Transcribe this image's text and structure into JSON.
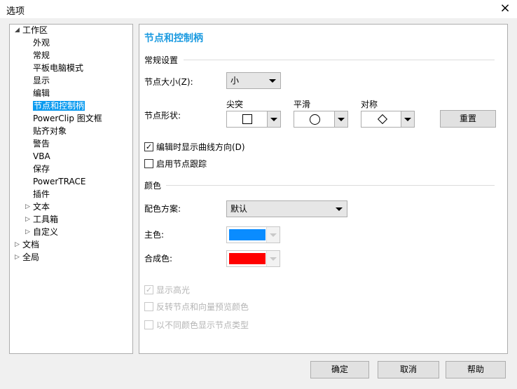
{
  "window": {
    "title": "选项",
    "close_icon": "×"
  },
  "tree": {
    "items": [
      {
        "label": "工作区",
        "level": 0,
        "expanded": true
      },
      {
        "label": "外观",
        "level": 1
      },
      {
        "label": "常规",
        "level": 1
      },
      {
        "label": "平板电脑模式",
        "level": 1
      },
      {
        "label": "显示",
        "level": 1
      },
      {
        "label": "编辑",
        "level": 1
      },
      {
        "label": "节点和控制柄",
        "level": 1,
        "selected": true
      },
      {
        "label": "PowerClip 图文框",
        "level": 1
      },
      {
        "label": "贴齐对象",
        "level": 1
      },
      {
        "label": "警告",
        "level": 1
      },
      {
        "label": "VBA",
        "level": 1
      },
      {
        "label": "保存",
        "level": 1
      },
      {
        "label": "PowerTRACE",
        "level": 1
      },
      {
        "label": "插件",
        "level": 1
      },
      {
        "label": "文本",
        "level": 1,
        "collapsed": true
      },
      {
        "label": "工具箱",
        "level": 1,
        "collapsed": true
      },
      {
        "label": "自定义",
        "level": 1,
        "collapsed": true
      },
      {
        "label": "文档",
        "level": 0,
        "collapsed": true
      },
      {
        "label": "全局",
        "level": 0,
        "collapsed": true
      }
    ]
  },
  "panel": {
    "title": "节点和控制柄",
    "general_section": "常规设置",
    "node_size_label": "节点大小(Z):",
    "node_size_value": "小",
    "node_shape_label": "节点形状:",
    "cusp_label": "尖突",
    "smooth_label": "平滑",
    "symmetric_label": "对称",
    "reset_label": "重置",
    "show_direction": {
      "label": "编辑时显示曲线方向(D)",
      "checked": true
    },
    "node_tracking": {
      "label": "启用节点跟踪",
      "checked": false
    },
    "color_section": "颜色",
    "scheme_label": "配色方案:",
    "scheme_value": "默认",
    "primary_label": "主色:",
    "primary_color": "#0a8cff",
    "composite_label": "合成色:",
    "composite_color": "#ff0000",
    "show_highlight": {
      "label": "显示高光",
      "checked": true,
      "disabled": true
    },
    "invert_preview": {
      "label": "反转节点和向量预览颜色",
      "checked": false,
      "disabled": true
    },
    "diff_colors": {
      "label": "以不同颜色显示节点类型",
      "checked": false,
      "disabled": true
    }
  },
  "buttons": {
    "ok": "确定",
    "cancel": "取消",
    "help": "帮助"
  }
}
